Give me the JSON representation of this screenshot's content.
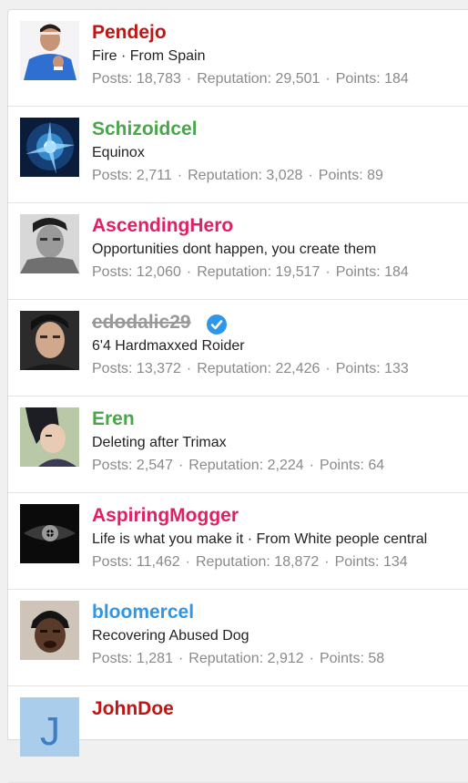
{
  "labels": {
    "posts": "Posts:",
    "reputation": "Reputation:",
    "points": "Points:",
    "separator": "·"
  },
  "colors": {
    "red": "#c01515",
    "green": "#4aa64a",
    "pink": "#e02064",
    "gray": "#999999",
    "blue": "#2f96e8"
  },
  "members": [
    {
      "username": "Pendejo",
      "color": "#c01515",
      "title": "Fire · From Spain",
      "posts": "18,783",
      "reputation": "29,501",
      "points": "184",
      "avatar": "tennis-player-photo"
    },
    {
      "username": "Schizoidcel",
      "color": "#4aa64a",
      "title": "Equinox",
      "posts": "2,711",
      "reputation": "3,028",
      "points": "89",
      "avatar": "blue-energy-art"
    },
    {
      "username": "AscendingHero",
      "color": "#e02064",
      "title": "Opportunities dont happen, you create them",
      "posts": "12,060",
      "reputation": "19,517",
      "points": "184",
      "avatar": "bw-male-portrait"
    },
    {
      "username": "edodalic29",
      "color": "#999999",
      "banned": true,
      "verified": true,
      "title": "6'4 Hardmaxxed Roider",
      "posts": "13,372",
      "reputation": "22,426",
      "points": "133",
      "avatar": "male-model-portrait"
    },
    {
      "username": "Eren",
      "color": "#4aa64a",
      "title": "Deleting after Trimax",
      "posts": "2,547",
      "reputation": "2,224",
      "points": "64",
      "avatar": "anime-character"
    },
    {
      "username": "AspiringMogger",
      "color": "#e02064",
      "title": "Life is what you make it · From White people central",
      "posts": "11,462",
      "reputation": "18,872",
      "points": "134",
      "avatar": "dark-eye-closeup"
    },
    {
      "username": "bloomercel",
      "color": "#2f96e8",
      "title": "Recovering Abused Dog",
      "posts": "1,281",
      "reputation": "2,912",
      "points": "58",
      "avatar": "man-with-durag"
    },
    {
      "username": "JohnDoe",
      "color": "#c01515",
      "title": "",
      "posts": "",
      "reputation": "",
      "points": "",
      "avatar": "letter-j-default-avatar",
      "avatar_letter": "J"
    }
  ]
}
